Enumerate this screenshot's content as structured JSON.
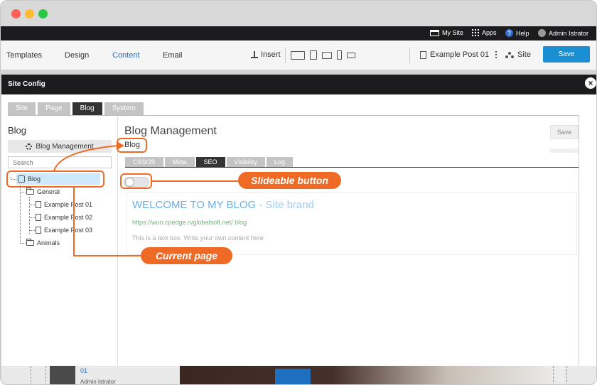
{
  "topbar": {
    "my_site": "My Site",
    "apps": "Apps",
    "help": "Help",
    "user": "Admin Istrator"
  },
  "toolbar": {
    "nav": [
      "Templates",
      "Design",
      "Content",
      "Email"
    ],
    "active_nav": "Content",
    "insert": "Insert",
    "doc_title": "Example Post 01",
    "site": "Site",
    "save": "Save"
  },
  "modal": {
    "title": "Site Config",
    "close": "×",
    "tabs": [
      "Site",
      "Page",
      "Blog",
      "System"
    ],
    "active_tab": "Blog"
  },
  "sidebar": {
    "heading": "Blog",
    "management": "Blog Management",
    "search_placeholder": "Search",
    "tree": {
      "root": "Blog",
      "general": "General",
      "posts": [
        "Example Post 01",
        "Example Post 02",
        "Example Post 03"
      ],
      "animals": "Animals"
    }
  },
  "main": {
    "heading": "Blog Management",
    "breadcrumb": "Blog",
    "save": "Save",
    "subtabs": [
      "CSS/JS",
      "Meta",
      "SEO",
      "Visibility",
      "Log"
    ],
    "active_subtab": "SEO",
    "preview": {
      "welcome": "WELCOME TO MY BLOG",
      "brand": " - Site brand",
      "url": "https://wun.cpedge.rvglobalsoft.net/ blog",
      "text": "This is a text box. Write your own content here"
    }
  },
  "background_page": {
    "post_number": "01",
    "author": "Admin Istrator"
  },
  "annotations": {
    "slideable": "Slideable button",
    "current_page": "Current page"
  },
  "colors": {
    "accent": "#1a8fd1",
    "callout": "#ef6a25",
    "selected_node": "#cde9fb",
    "dark_bar": "#1c1c1e"
  }
}
